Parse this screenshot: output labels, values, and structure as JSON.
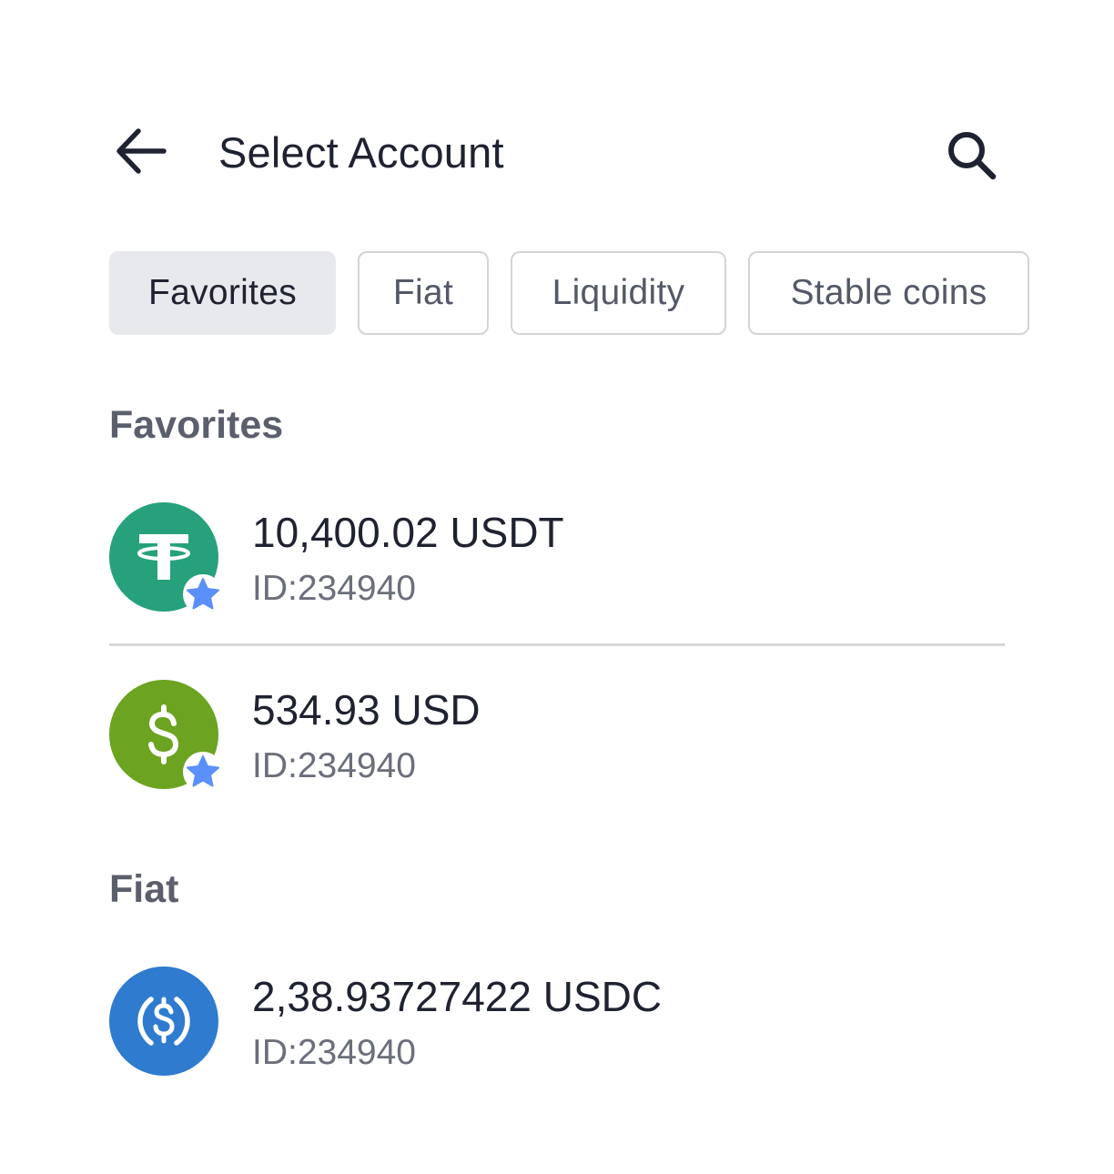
{
  "header": {
    "title": "Select Account",
    "back_icon": "arrow-left-icon",
    "search_icon": "search-icon"
  },
  "filters": [
    {
      "label": "Favorites",
      "active": true
    },
    {
      "label": "Fiat",
      "active": false
    },
    {
      "label": "Liquidity",
      "active": false
    },
    {
      "label": "Stable coins",
      "active": false
    }
  ],
  "sections": [
    {
      "title": "Favorites",
      "accounts": [
        {
          "amount": "10,400.02 USDT",
          "id": "ID:234940",
          "icon": "tether-icon",
          "color": "#26a17b",
          "favorite": true
        },
        {
          "amount": "534.93 USD",
          "id": "ID:234940",
          "icon": "dollar-icon",
          "color": "#6ca320",
          "favorite": true
        }
      ]
    },
    {
      "title": "Fiat",
      "accounts": [
        {
          "amount": "2,38.93727422 USDC",
          "id": "ID:234940",
          "icon": "usdc-icon",
          "color": "#2f7bcf",
          "favorite": false
        }
      ]
    }
  ],
  "colors": {
    "favorite_star": "#5b8ff9",
    "chip_active_bg": "#e7e9ec",
    "chip_border": "#d2d4d8"
  }
}
